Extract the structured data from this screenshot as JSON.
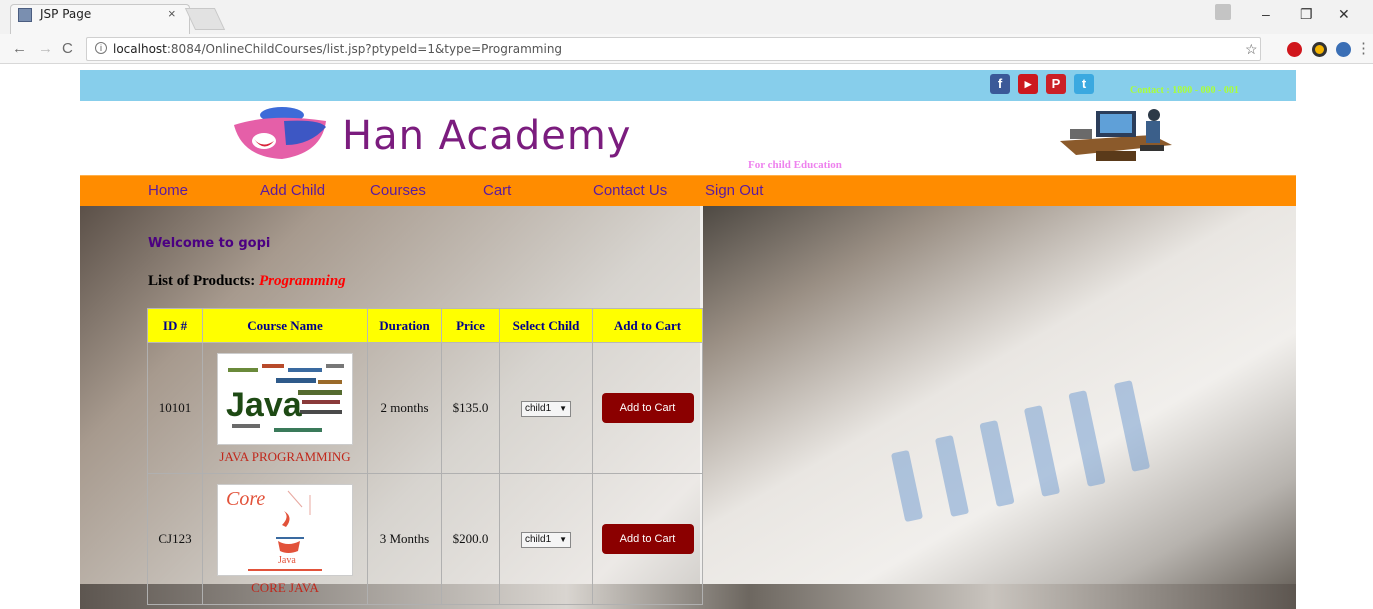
{
  "browser": {
    "tab_title": "JSP Page",
    "tab_close": "×",
    "url_host": "localhost",
    "url_rest": ":8084/OnlineChildCourses/list.jsp?ptypeId=1&type=Programming",
    "window_min": "–",
    "window_max": "❐",
    "window_close": "✕"
  },
  "site": {
    "contact": "Contact : 1800 - 000 - 001",
    "brand": "Han Academy",
    "tagline": "For child Education",
    "nav": [
      "Home",
      "Add Child",
      "Courses",
      "Cart",
      "Contact Us",
      "Sign Out"
    ],
    "welcome": "Welcome to gopi",
    "list_label": "List of Products:",
    "list_category": "Programming"
  },
  "table": {
    "headers": [
      "ID #",
      "Course Name",
      "Duration",
      "Price",
      "Select Child",
      "Add to Cart"
    ],
    "rows": [
      {
        "id": "10101",
        "name": "JAVA PROGRAMMING",
        "image": "java-wordcloud",
        "image_text": "Java",
        "duration": "2 months",
        "price": "$135.0",
        "child": "child1",
        "button": "Add to Cart"
      },
      {
        "id": "CJ123",
        "name": "CORE JAVA",
        "image": "core-java-logo",
        "image_text": "Core",
        "image_sub": "Java",
        "duration": "3 Months",
        "price": "$200.0",
        "child": "child1",
        "button": "Add to Cart"
      }
    ]
  },
  "colors": {
    "top_strip": "#87ceeb",
    "navbar": "#ff8c00",
    "nav_text": "#5a1ba0",
    "table_header": "#ffff00",
    "cart_button": "#8b0000",
    "brand": "#7b1c7e"
  }
}
